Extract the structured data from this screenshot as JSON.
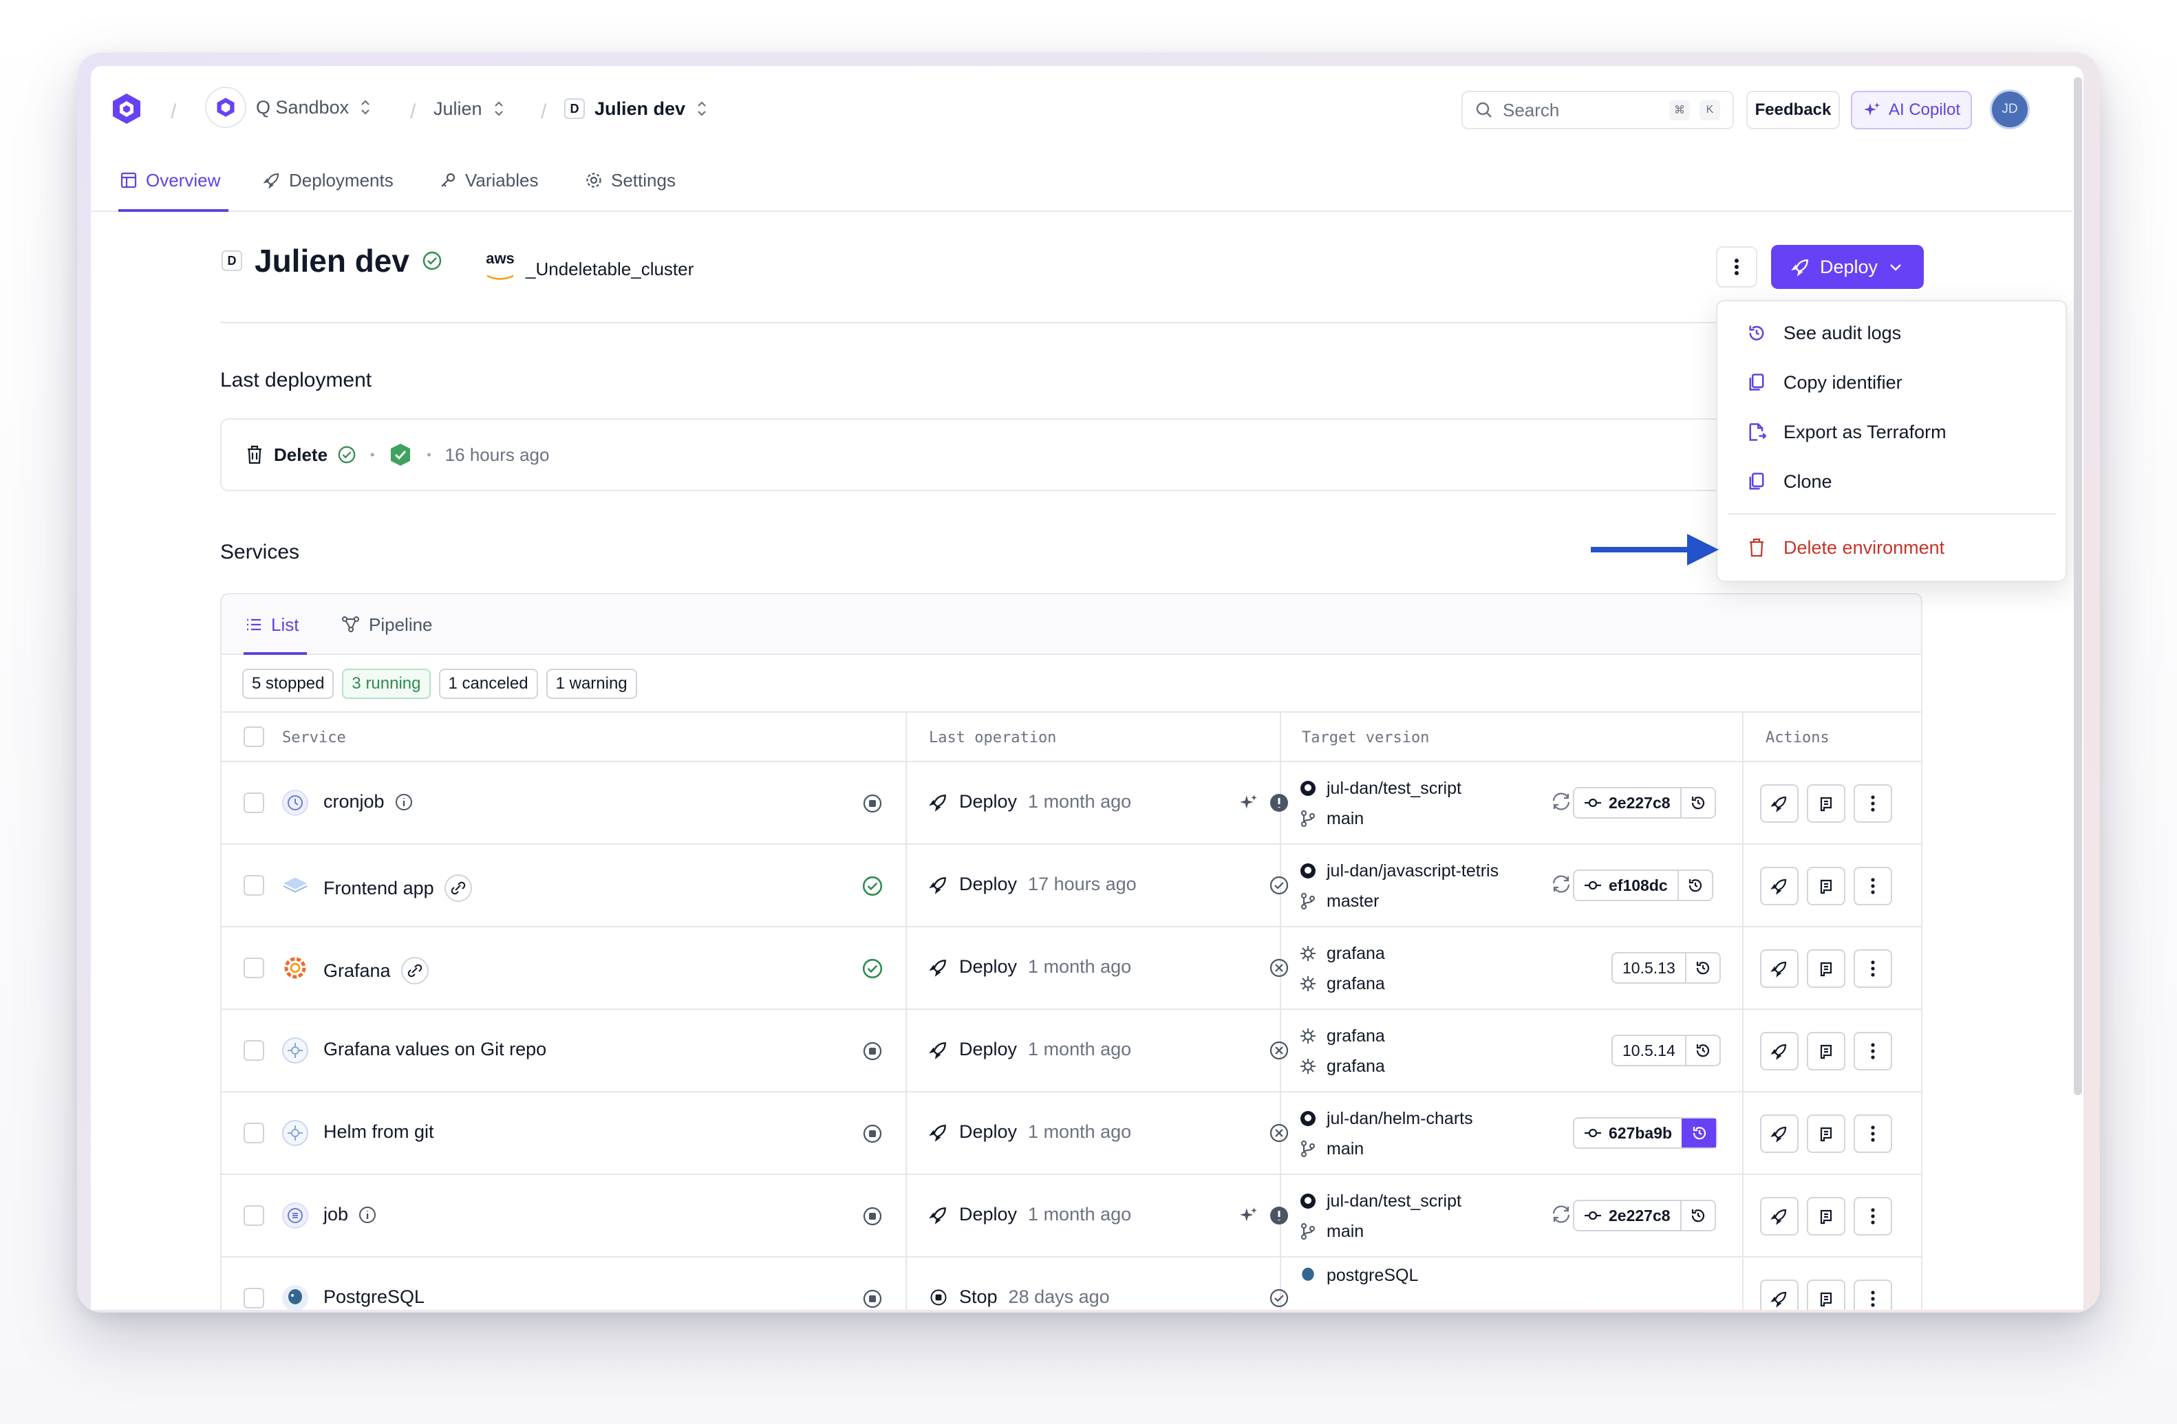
{
  "breadcrumb": {
    "org": "Q Sandbox",
    "project": "Julien",
    "env_badge": "D",
    "environment": "Julien dev"
  },
  "search": {
    "placeholder": "Search",
    "kbd_cmd": "⌘",
    "kbd_key": "K"
  },
  "toolbar": {
    "feedback": "Feedback",
    "copilot": "AI Copilot",
    "avatar": "JD"
  },
  "nav": {
    "tabs": [
      "Overview",
      "Deployments",
      "Variables",
      "Settings"
    ],
    "active": "Overview"
  },
  "header": {
    "env_badge": "D",
    "title": "Julien dev",
    "cloud_provider": "aws",
    "cluster": "_Undeletable_cluster",
    "deploy_label": "Deploy"
  },
  "last_deployment": {
    "section_title": "Last deployment",
    "action": "Delete",
    "time": "16 hours ago"
  },
  "dropdown": {
    "items": [
      "See audit logs",
      "Copy identifier",
      "Export as Terraform",
      "Clone"
    ],
    "danger_item": "Delete environment"
  },
  "services": {
    "section_title": "Services",
    "view_tabs": [
      "List",
      "Pipeline"
    ],
    "filters": [
      "5 stopped",
      "3 running",
      "1 canceled",
      "1 warning"
    ],
    "columns": [
      "Service",
      "Last operation",
      "Target version",
      "Actions"
    ],
    "rows": [
      {
        "name": "cronjob",
        "operation": "Deploy",
        "time": "1 month ago",
        "repo": "jul-dan/test_script",
        "branch": "main",
        "version": "2e227c8"
      },
      {
        "name": "Frontend app",
        "operation": "Deploy",
        "time": "17 hours ago",
        "repo": "jul-dan/javascript-tetris",
        "branch": "master",
        "version": "ef108dc"
      },
      {
        "name": "Grafana",
        "operation": "Deploy",
        "time": "1 month ago",
        "repo": "grafana",
        "branch": "grafana",
        "version": "10.5.13"
      },
      {
        "name": "Grafana values on Git repo",
        "operation": "Deploy",
        "time": "1 month ago",
        "repo": "grafana",
        "branch": "grafana",
        "version": "10.5.14"
      },
      {
        "name": "Helm from git",
        "operation": "Deploy",
        "time": "1 month ago",
        "repo": "jul-dan/helm-charts",
        "branch": "main",
        "version": "627ba9b"
      },
      {
        "name": "job",
        "operation": "Deploy",
        "time": "1 month ago",
        "repo": "jul-dan/test_script",
        "branch": "main",
        "version": "2e227c8"
      },
      {
        "name": "PostgreSQL",
        "operation": "Stop",
        "time": "28 days ago",
        "repo": "postgreSQL",
        "branch": "",
        "version": ""
      }
    ]
  },
  "colors": {
    "accent": "#6741f5",
    "danger": "#c4352b",
    "success": "#2f8b4e",
    "arrow": "#2452c9"
  }
}
